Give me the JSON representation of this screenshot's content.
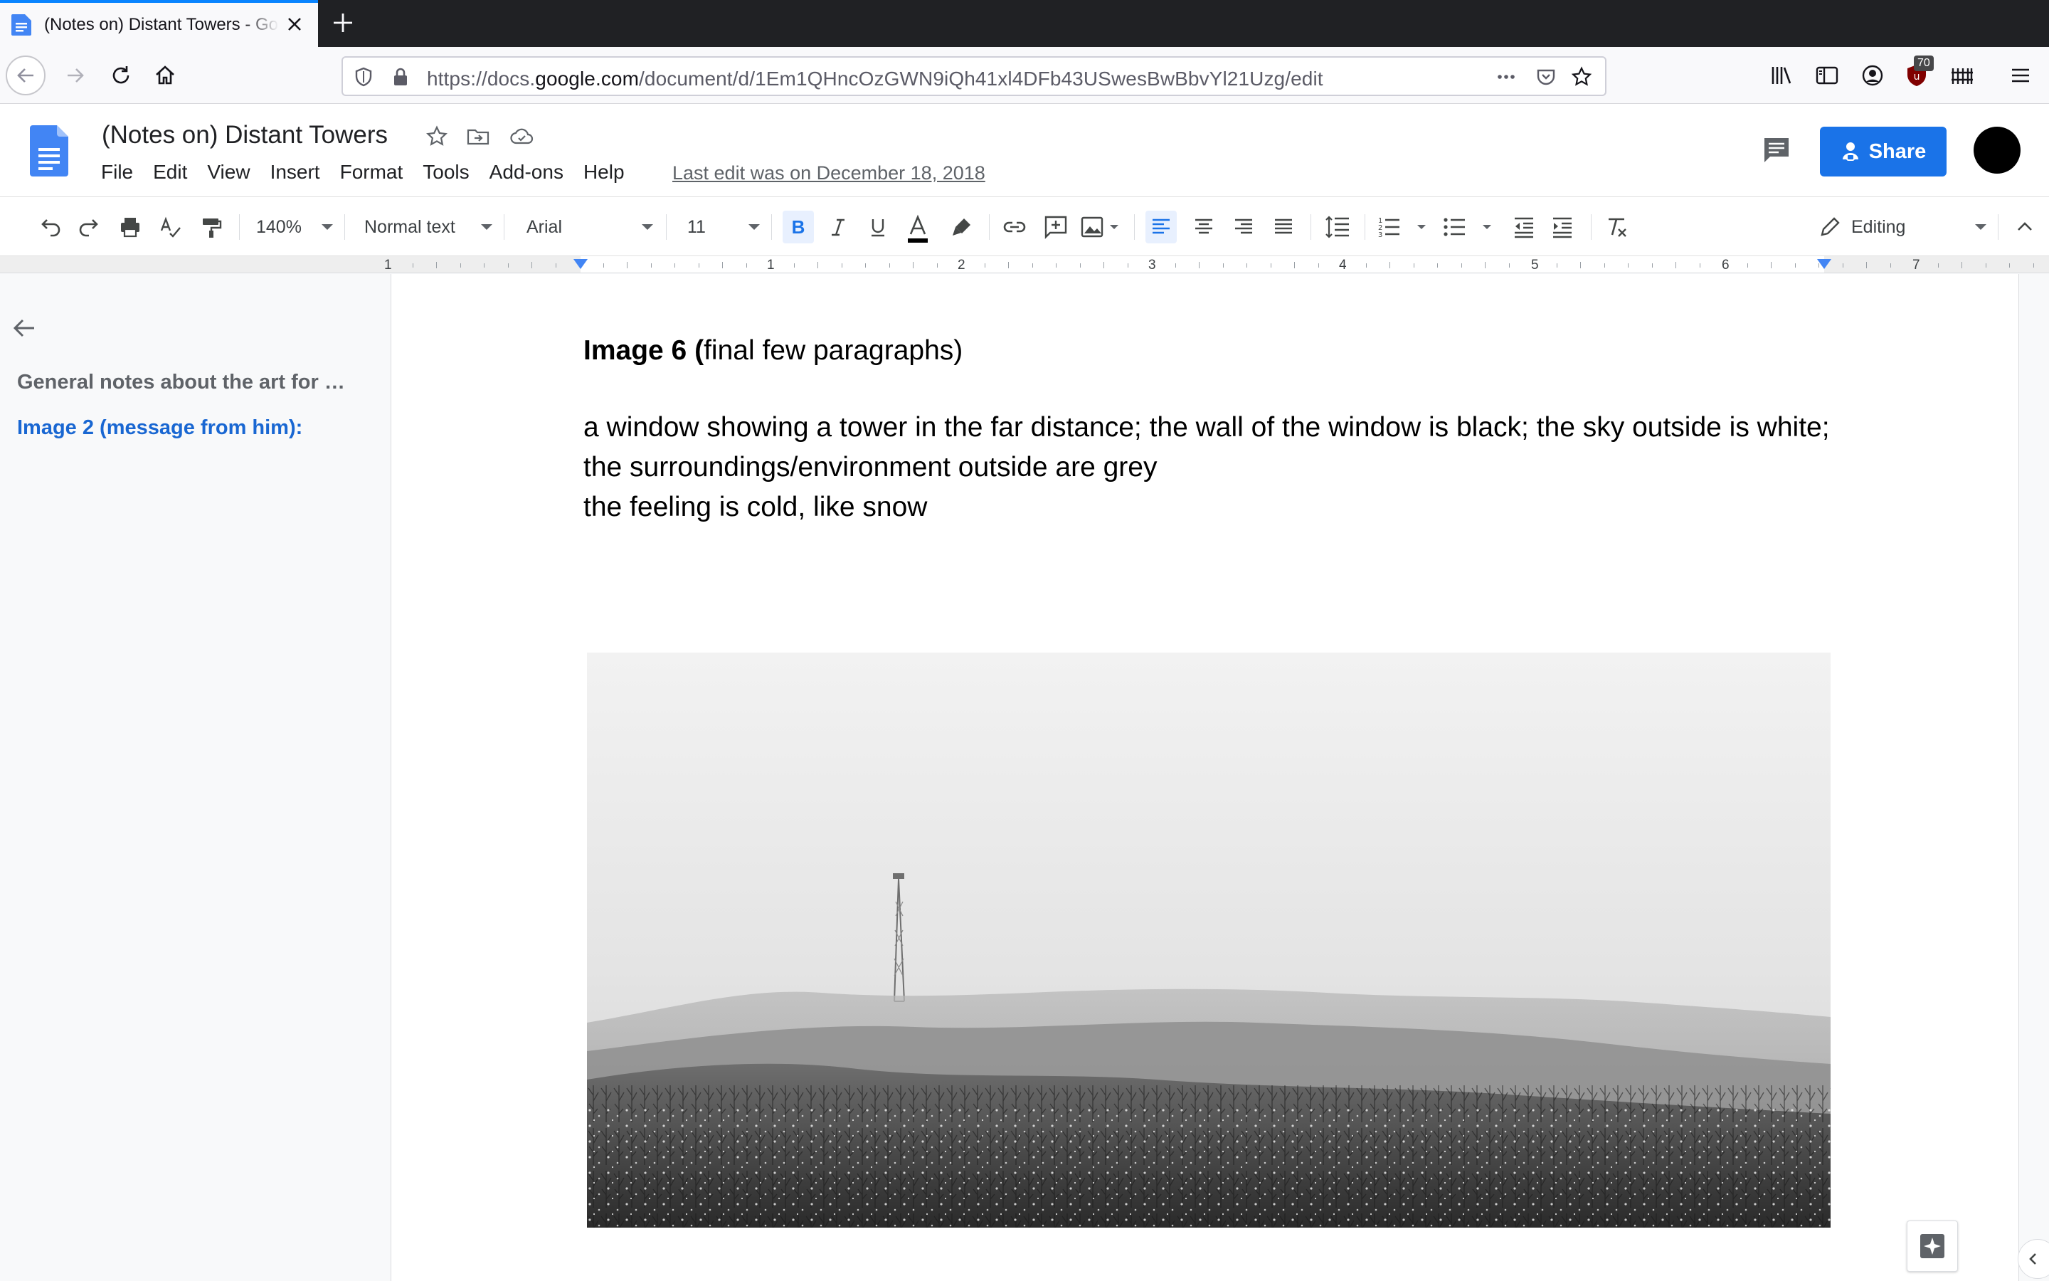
{
  "browser": {
    "tab_title": "(Notes on) Distant Towers - Google Docs",
    "url_prefix": "https://docs.",
    "url_host": "google.com",
    "url_path": "/document/d/1Em1QHncOzGWN9iQh41xl4DFb43USwesBwBbvYl21Uzg/edit",
    "addon_badge": "70"
  },
  "docs": {
    "title": "(Notes on) Distant Towers",
    "menu": [
      "File",
      "Edit",
      "View",
      "Insert",
      "Format",
      "Tools",
      "Add-ons",
      "Help"
    ],
    "last_edit": "Last edit was on December 18, 2018",
    "share_label": "Share"
  },
  "toolbar": {
    "zoom": "140%",
    "style": "Normal text",
    "font": "Arial",
    "font_size": "11",
    "mode": "Editing"
  },
  "ruler": {
    "labels": [
      "1",
      "1",
      "2",
      "3",
      "4",
      "5",
      "6",
      "7"
    ]
  },
  "outline": {
    "items": [
      {
        "label": "General notes about the art for …"
      },
      {
        "label": "Image 2 (message from him):"
      }
    ]
  },
  "document": {
    "heading_bold": "Image 6 (",
    "heading_rest": "final few paragraphs)",
    "paragraph1": "a window showing a tower in the far distance; the wall of the window is black; the sky outside is white; the surroundings/environment outside are grey",
    "paragraph2": "the feeling is cold, like snow"
  },
  "colors": {
    "accent": "#1a73e8",
    "outline_link": "#1967d2",
    "firefox_accent": "#0a84ff"
  }
}
